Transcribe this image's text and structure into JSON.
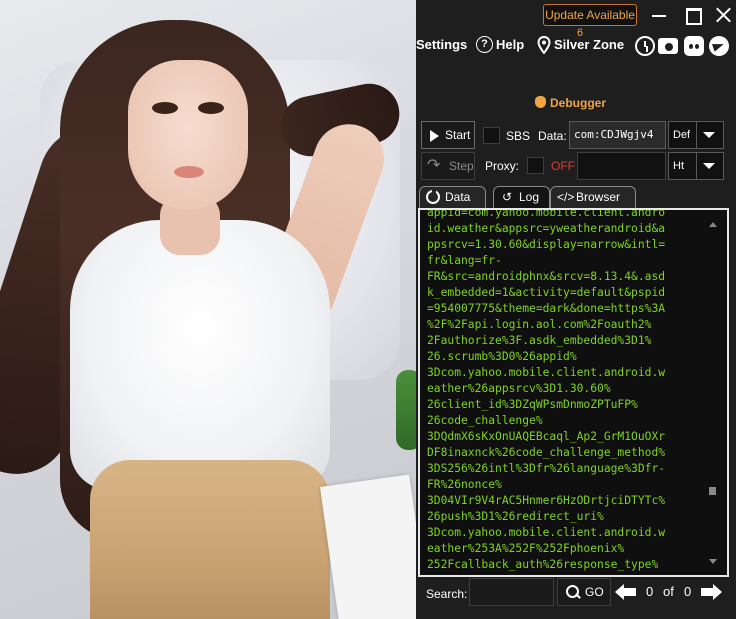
{
  "titlebar": {
    "update_label": "Update Available",
    "update_count": "6"
  },
  "menu": {
    "settings": "Settings",
    "help": "Help",
    "help_icon": "?",
    "zone": "Silver Zone",
    "icons": [
      "history-icon",
      "camera-icon",
      "discord-icon",
      "telegram-icon"
    ]
  },
  "debugger": {
    "label": "Debugger"
  },
  "controls": {
    "start": "Start",
    "step": "Step",
    "sbs": "SBS",
    "data_label": "Data:",
    "data_value": "com:CDJWgjv4",
    "data_combo": "Def",
    "proxy_label": "Proxy:",
    "proxy_state": "OFF",
    "proxy_combo": "Ht"
  },
  "tabs": [
    {
      "label": "Data"
    },
    {
      "label": "Log",
      "active": true
    },
    {
      "label": "Browser"
    }
  ],
  "log": {
    "lines": [
      "appid=com.yahoo.mobile.client.andro",
      "id.weather&appsrc=yweatherandroid&a",
      "ppsrcv=1.30.60&display=narrow&intl=",
      "fr&lang=fr-",
      "FR&src=androidphnx&srcv=8.13.4&.asd",
      "k_embedded=1&activity=default&pspid",
      "=954007775&theme=dark&done=https%3A",
      "%2F%2Fapi.login.aol.com%2Foauth2%",
      "2Fauthorize%3F.asdk_embedded%3D1%",
      "26.scrumb%3D0%26appid%",
      "3Dcom.yahoo.mobile.client.android.w",
      "eather%26appsrcv%3D1.30.60%",
      "26client_id%3DZqWPsmDnmoZPTuFP%",
      "26code_challenge%",
      "3DQdmX6sKxOnUAQEBcaql_Ap2_GrM1OuOXr",
      "DF8inaxnck%26code_challenge_method%",
      "3DS256%26intl%3Dfr%26language%3Dfr-",
      "FR%26nonce%",
      "3D04VIr9V4rAC5Hnmer6HzODrtjciDTYTc%",
      "26push%3D1%26redirect_uri%",
      "3Dcom.yahoo.mobile.client.android.w",
      "eather%253A%252F%252Fphoenix%",
      "252Fcallback_auth%26response_type%"
    ],
    "color": "#7ed321"
  },
  "search": {
    "label": "Search:",
    "go": "GO",
    "current": "0",
    "of": "of",
    "total": "0"
  },
  "colors": {
    "accent": "#f1a444",
    "panel_bg": "#1e1e1e",
    "log_text": "#7ed321",
    "off_red": "#e53935"
  }
}
